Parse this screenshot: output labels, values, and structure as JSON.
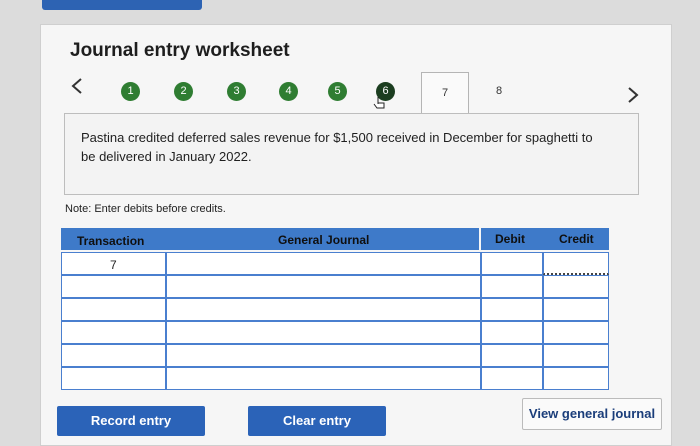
{
  "worksheet": {
    "title": "Journal entry worksheet",
    "steps": [
      "1",
      "2",
      "3",
      "4",
      "5",
      "6"
    ],
    "active_tab": "7",
    "next_tab": "8",
    "description": "Pastina credited deferred sales revenue for $1,500 received in December for spaghetti to be delivered in January 2022.",
    "note": "Note: Enter debits before credits."
  },
  "table": {
    "headers": {
      "transaction": "Transaction",
      "general_journal": "General Journal",
      "debit": "Debit",
      "credit": "Credit"
    },
    "rows": [
      {
        "transaction": "7",
        "account": "",
        "debit": "",
        "credit": ""
      },
      {
        "transaction": "",
        "account": "",
        "debit": "",
        "credit": ""
      },
      {
        "transaction": "",
        "account": "",
        "debit": "",
        "credit": ""
      },
      {
        "transaction": "",
        "account": "",
        "debit": "",
        "credit": ""
      },
      {
        "transaction": "",
        "account": "",
        "debit": "",
        "credit": ""
      },
      {
        "transaction": "",
        "account": "",
        "debit": "",
        "credit": ""
      }
    ]
  },
  "buttons": {
    "record": "Record entry",
    "clear": "Clear entry",
    "view": "View general journal"
  }
}
